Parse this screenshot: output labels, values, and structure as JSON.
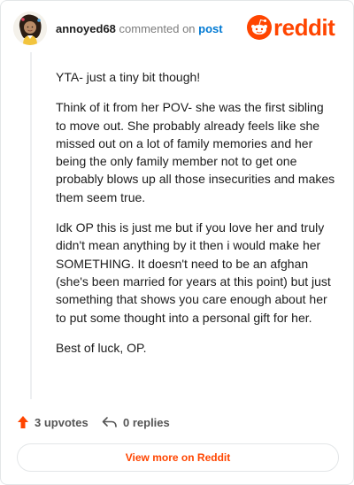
{
  "comment": {
    "author": "annoyed68",
    "commented_text": "commented on",
    "post_link": "post",
    "paragraphs": [
      "YTA- just a tiny bit though!",
      "Think of it from her POV- she was the first sibling to move out. She probably already feels like she missed out on a lot of family memories and her being the only family member not to get one probably blows up all those insecurities and makes them seem true.",
      "Idk OP this is just me but if you love her and truly didn't mean anything by it then i would make her SOMETHING. It doesn't need to be an afghan (she's been married for years at this point) but just something that shows you care enough about her to put some thought into a personal gift for her.",
      "Best of luck, OP."
    ],
    "upvotes": "3 upvotes",
    "replies": "0 replies"
  },
  "brand": {
    "wordmark": "reddit",
    "color": "#ff4500"
  },
  "cta": {
    "label": "View more on Reddit"
  },
  "icons": [
    "avatar",
    "reddit-logo-icon",
    "upvote-arrow-icon",
    "reply-arrow-icon"
  ]
}
